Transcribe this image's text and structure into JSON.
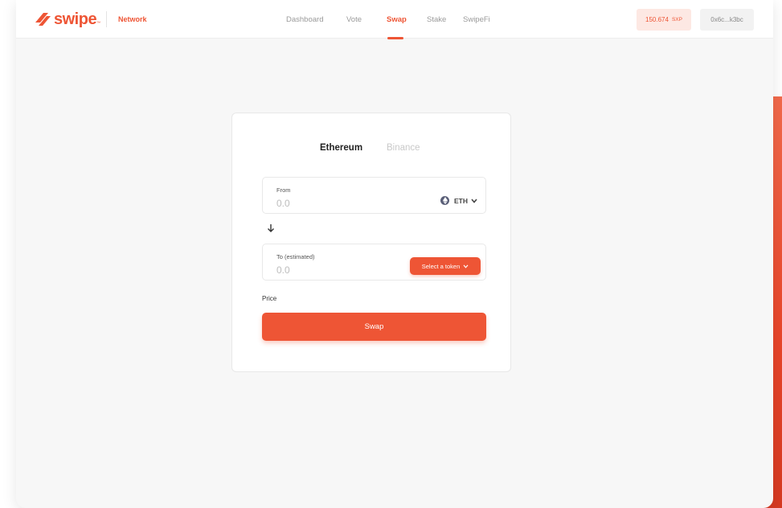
{
  "brand": {
    "logo_text": "swipe",
    "logo_mark": "™",
    "accent_color": "#ee5535"
  },
  "header": {
    "network_label": "Network",
    "nav": [
      {
        "label": "Dashboard",
        "active": false
      },
      {
        "label": "Vote",
        "active": false
      },
      {
        "label": "Swap",
        "active": true
      },
      {
        "label": "Stake",
        "active": false
      },
      {
        "label": "SwipeFi",
        "active": false
      }
    ],
    "balance": {
      "amount": "150.674",
      "unit": "SXP"
    },
    "wallet_address": "0x6c...k3bc"
  },
  "swap": {
    "chains": [
      {
        "label": "Ethereum",
        "active": true
      },
      {
        "label": "Binance",
        "active": false
      }
    ],
    "from": {
      "label": "From",
      "placeholder": "0.0",
      "token": "ETH",
      "token_icon": "ethereum-icon"
    },
    "direction_icon": "arrow-down-icon",
    "to": {
      "label": "To (estimated)",
      "placeholder": "0.0",
      "select_label": "Select a token"
    },
    "price_label": "Price",
    "submit_label": "Swap"
  }
}
